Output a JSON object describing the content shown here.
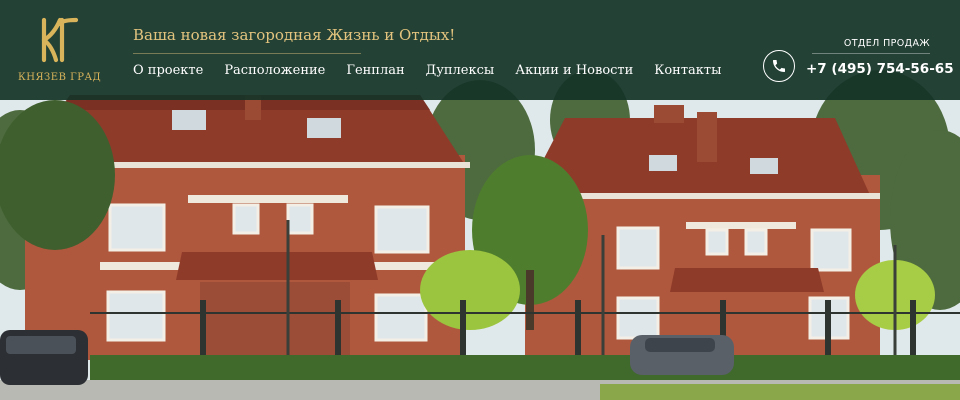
{
  "brand": {
    "logo_text": "КНЯЗЕВ ГРАД",
    "logo_monogram": "КГ"
  },
  "header": {
    "tagline": "Ваша новая загородная Жизнь и Отдых!",
    "nav": [
      {
        "label": "О проекте"
      },
      {
        "label": "Расположение"
      },
      {
        "label": "Генплан"
      },
      {
        "label": "Дуплексы"
      },
      {
        "label": "Акции и Новости"
      },
      {
        "label": "Контакты"
      }
    ],
    "sales_label": "ОТДЕЛ ПРОДАЖ",
    "phone": "+7 (495) 754-56-65",
    "phone_icon": "phone-icon"
  },
  "colors": {
    "header_bg": "#163428",
    "accent_gold": "#d9b45a",
    "tagline": "#e3c47e",
    "text": "#ffffff"
  }
}
